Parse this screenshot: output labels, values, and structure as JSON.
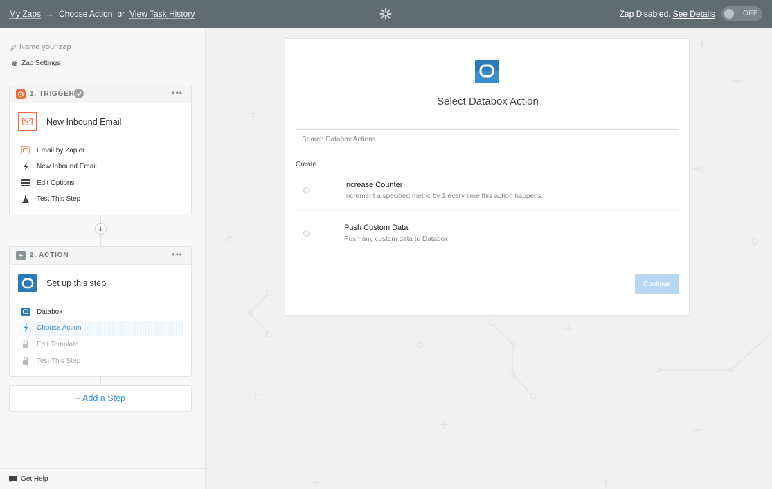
{
  "header": {
    "my_zaps": "My Zaps",
    "arrow": "→",
    "current": "Choose Action",
    "or": "or",
    "task_history": "View Task History",
    "status": "Zap Disabled.",
    "see_details": "See Details",
    "toggle_label": "OFF"
  },
  "sidebar": {
    "name_placeholder": "Name your zap",
    "settings": "Zap Settings",
    "trigger": {
      "title": "1. TRIGGER",
      "step_label": "New Inbound Email",
      "items": [
        "Email by Zapier",
        "New Inbound Email",
        "Edit Options",
        "Test This Step"
      ]
    },
    "action": {
      "title": "2. ACTION",
      "step_label": "Set up this step",
      "items": [
        "Databox",
        "Choose Action",
        "Edit Template",
        "Test This Step"
      ]
    },
    "add_step": "+ Add a Step",
    "get_help": "Get Help"
  },
  "panel": {
    "title": "Select Databox Action",
    "search_placeholder": "Search Databox Actions...",
    "section": "Create",
    "options": [
      {
        "name": "Increase Counter",
        "desc": "Increment a specified metric by 1 every time this action happens."
      },
      {
        "name": "Push Custom Data",
        "desc": "Push any custom data to Databox."
      }
    ],
    "continue": "Continue"
  },
  "colors": {
    "topbar": "#5f6c72",
    "accent": "#3a8fd0",
    "email_orange": "#f26b3a",
    "databox_blue": "#2a7ab8",
    "continue_disabled": "#b8d7f0"
  }
}
